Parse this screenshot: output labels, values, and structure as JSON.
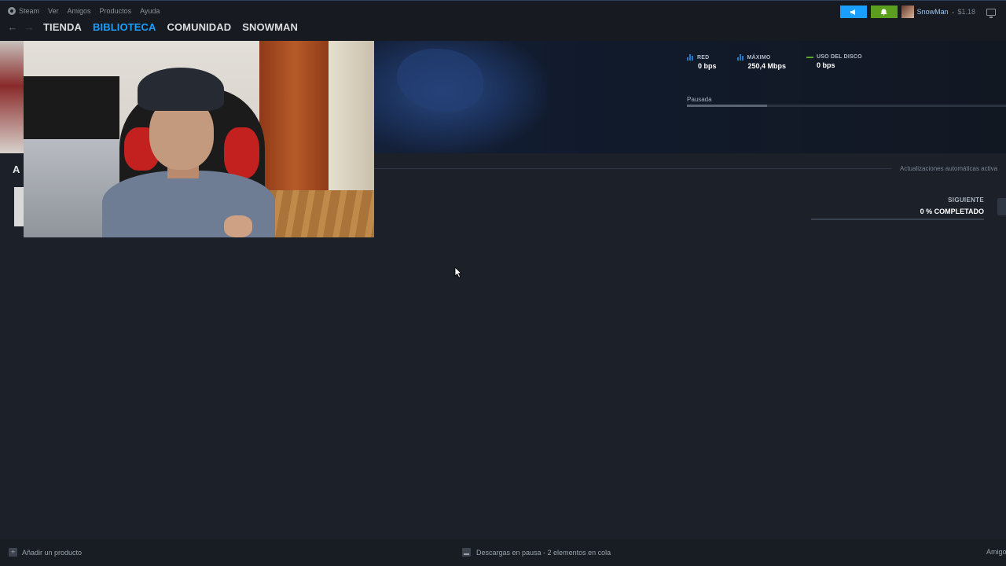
{
  "menubar": {
    "app_name": "Steam",
    "items": [
      "Ver",
      "Amigos",
      "Productos",
      "Ayuda"
    ]
  },
  "nav": {
    "tabs": [
      {
        "label": "TIENDA",
        "active": false
      },
      {
        "label": "BIBLIOTECA",
        "active": true
      },
      {
        "label": "COMUNIDAD",
        "active": false
      },
      {
        "label": "SNOWMAN",
        "active": false
      }
    ]
  },
  "account": {
    "username": "SnowMan",
    "wallet": "$1.18"
  },
  "downloads": {
    "stats": [
      {
        "label": "RED",
        "value": "0 bps",
        "icon": "bar-graph-icon",
        "color": "#2d78c4"
      },
      {
        "label": "MÁXIMO",
        "value": "250,4 Mbps",
        "icon": "bar-graph-icon",
        "color": "#2d78c4"
      },
      {
        "label": "USO DEL DISCO",
        "value": "0 bps",
        "icon": "disk-line-icon",
        "color": "#5ba32b"
      }
    ],
    "status_label": "Pausada",
    "status_progress": 0.25,
    "auto_updates": "Actualizaciones automáticas activa",
    "section_letter": "A",
    "next": {
      "label": "SIGUIENTE",
      "progress_text": "0 % COMPLETADO"
    }
  },
  "footer": {
    "add_product": "Añadir un producto",
    "download_status": "Descargas en pausa - 2 elementos en cola",
    "friends": "Amigo"
  },
  "colors": {
    "accent": "#1a9fff",
    "notification": "#5c9e1d",
    "background": "#1b2029"
  }
}
